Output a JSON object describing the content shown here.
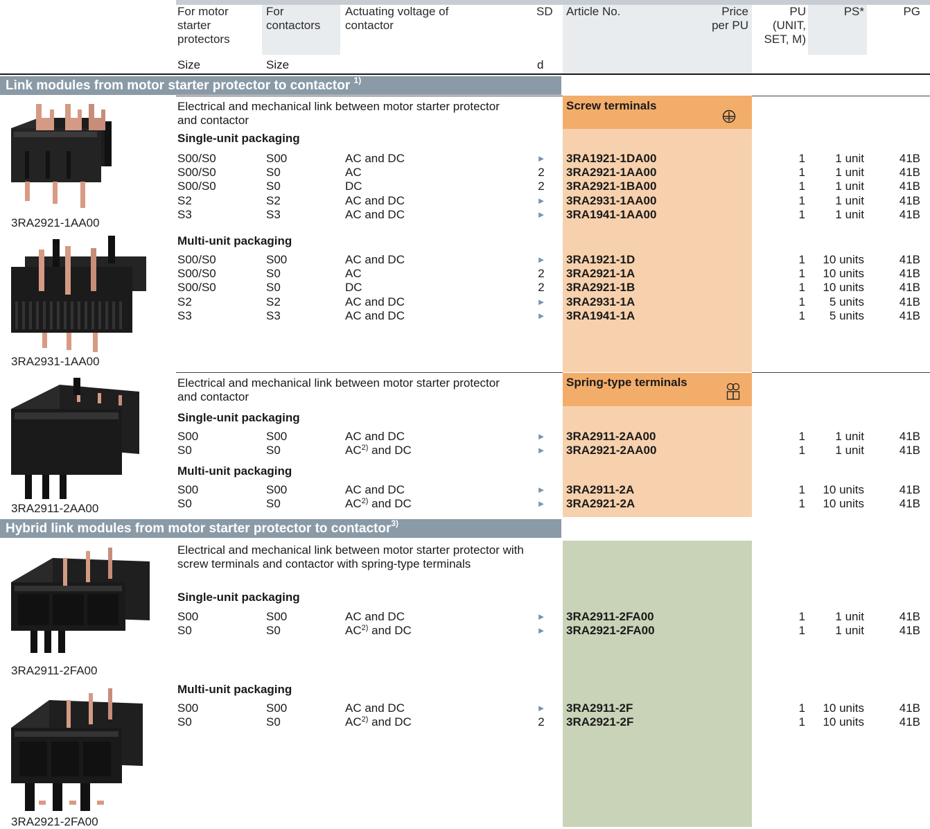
{
  "header": {
    "col_motor": "For motor starter protectors",
    "col_contactors": "For contactors",
    "col_voltage": "Actuating voltage of contactor",
    "col_sd": "SD",
    "col_article": "Article No.",
    "col_price": "Price per PU",
    "col_pu": "PU (UNIT, SET, M)",
    "col_ps": "PS*",
    "col_pg": "PG",
    "sub_size1": "Size",
    "sub_size2": "Size",
    "sub_sd": "d"
  },
  "section1": {
    "title": "Link modules from motor starter protector to contactor",
    "footnote": "1)",
    "group1": {
      "description": "Electrical and mechanical link between motor starter protector and contactor",
      "terminal_type": "Screw terminals",
      "single_label": "Single-unit packaging",
      "single_rows": [
        {
          "s1": "S00/S0",
          "s2": "S00",
          "volt": "AC and DC",
          "sd": "►",
          "art": "3RA1921-1DA00",
          "pu": "1",
          "ps": "1 unit",
          "pg": "41B"
        },
        {
          "s1": "S00/S0",
          "s2": "S0",
          "volt": "AC",
          "sd": "2",
          "art": "3RA2921-1AA00",
          "pu": "1",
          "ps": "1 unit",
          "pg": "41B"
        },
        {
          "s1": "S00/S0",
          "s2": "S0",
          "volt": "DC",
          "sd": "2",
          "art": "3RA2921-1BA00",
          "pu": "1",
          "ps": "1 unit",
          "pg": "41B"
        },
        {
          "s1": "S2",
          "s2": "S2",
          "volt": "AC and DC",
          "sd": "►",
          "art": "3RA2931-1AA00",
          "pu": "1",
          "ps": "1 unit",
          "pg": "41B"
        },
        {
          "s1": "S3",
          "s2": "S3",
          "volt": "AC and DC",
          "sd": "►",
          "art": "3RA1941-1AA00",
          "pu": "1",
          "ps": "1 unit",
          "pg": "41B"
        }
      ],
      "multi_label": "Multi-unit packaging",
      "multi_rows": [
        {
          "s1": "S00/S0",
          "s2": "S00",
          "volt": "AC and DC",
          "sd": "►",
          "art": "3RA1921-1D",
          "pu": "1",
          "ps": "10 units",
          "pg": "41B"
        },
        {
          "s1": "S00/S0",
          "s2": "S0",
          "volt": "AC",
          "sd": "2",
          "art": "3RA2921-1A",
          "pu": "1",
          "ps": "10 units",
          "pg": "41B"
        },
        {
          "s1": "S00/S0",
          "s2": "S0",
          "volt": "DC",
          "sd": "2",
          "art": "3RA2921-1B",
          "pu": "1",
          "ps": "10 units",
          "pg": "41B"
        },
        {
          "s1": "S2",
          "s2": "S2",
          "volt": "AC and DC",
          "sd": "►",
          "art": "3RA2931-1A",
          "pu": "1",
          "ps": "5 units",
          "pg": "41B"
        },
        {
          "s1": "S3",
          "s2": "S3",
          "volt": "AC and DC",
          "sd": "►",
          "art": "3RA1941-1A",
          "pu": "1",
          "ps": "5 units",
          "pg": "41B"
        }
      ],
      "caption_a": "3RA2921-1AA00",
      "caption_b": "3RA2931-1AA00"
    },
    "group2": {
      "description": "Electrical and mechanical link between motor starter protector and contactor",
      "terminal_type": "Spring-type terminals",
      "single_label": "Single-unit packaging",
      "single_rows": [
        {
          "s1": "S00",
          "s2": "S00",
          "volt": "AC and DC",
          "sd": "►",
          "art": "3RA2911-2AA00",
          "pu": "1",
          "ps": "1 unit",
          "pg": "41B"
        },
        {
          "s1": "S0",
          "s2": "S0",
          "volt_a": "AC",
          "volt_sup": "2)",
          "volt_b": " and DC",
          "sd": "►",
          "art": "3RA2921-2AA00",
          "pu": "1",
          "ps": "1 unit",
          "pg": "41B"
        }
      ],
      "multi_label": "Multi-unit packaging",
      "multi_rows": [
        {
          "s1": "S00",
          "s2": "S00",
          "volt": "AC and DC",
          "sd": "►",
          "art": "3RA2911-2A",
          "pu": "1",
          "ps": "10 units",
          "pg": "41B"
        },
        {
          "s1": "S0",
          "s2": "S0",
          "volt_a": "AC",
          "volt_sup": "2)",
          "volt_b": " and DC",
          "sd": "►",
          "art": "3RA2921-2A",
          "pu": "1",
          "ps": "10 units",
          "pg": "41B"
        }
      ],
      "caption": "3RA2911-2AA00"
    }
  },
  "section2": {
    "title": "Hybrid link modules from motor starter protector to contactor",
    "footnote": "3)",
    "description": "Electrical and mechanical link between motor starter protector with screw terminals and contactor with spring-type terminals",
    "single_label": "Single-unit packaging",
    "single_rows": [
      {
        "s1": "S00",
        "s2": "S00",
        "volt": "AC and DC",
        "sd": "►",
        "art": "3RA2911-2FA00",
        "pu": "1",
        "ps": "1 unit",
        "pg": "41B"
      },
      {
        "s1": "S0",
        "s2": "S0",
        "volt_a": "AC",
        "volt_sup": "2)",
        "volt_b": " and DC",
        "sd": "►",
        "art": "3RA2921-2FA00",
        "pu": "1",
        "ps": "1 unit",
        "pg": "41B"
      }
    ],
    "multi_label": "Multi-unit packaging",
    "multi_rows": [
      {
        "s1": "S00",
        "s2": "S00",
        "volt": "AC and DC",
        "sd": "►",
        "art": "3RA2911-2F",
        "pu": "1",
        "ps": "10 units",
        "pg": "41B"
      },
      {
        "s1": "S0",
        "s2": "S0",
        "volt_a": "AC",
        "volt_sup": "2)",
        "volt_b": " and DC",
        "sd": "2",
        "art": "3RA2921-2F",
        "pu": "1",
        "ps": "10 units",
        "pg": "41B"
      }
    ],
    "caption_a": "3RA2911-2FA00",
    "caption_b": "3RA2921-2FA00"
  },
  "colors": {
    "section_bar": "#8a9aa7",
    "orange_strong": "#f3ad6b",
    "orange_light": "#f7d1ad",
    "green_light": "#c9d3b7",
    "header_bg": "#e9ecef",
    "arrow": "#7d93ab"
  },
  "icons": {
    "screw": "screw-terminal-icon",
    "spring": "spring-terminal-icon"
  }
}
